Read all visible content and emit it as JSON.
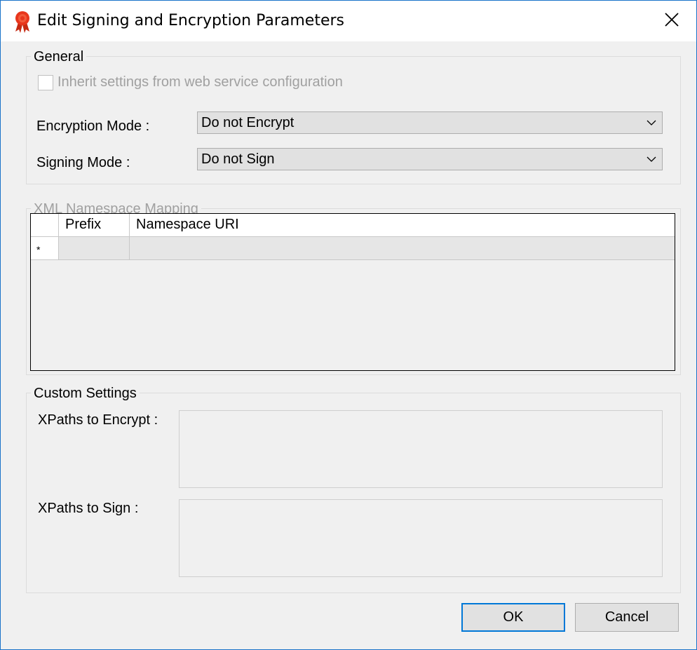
{
  "window": {
    "title": "Edit Signing and Encryption Parameters"
  },
  "general": {
    "title": "General",
    "inherit_label": "Inherit settings from web service configuration",
    "inherit_checked": false,
    "encryption_label": "Encryption Mode :",
    "encryption_value": "Do not Encrypt",
    "signing_label": "Signing Mode :",
    "signing_value": "Do not Sign"
  },
  "xml_mapping": {
    "title": "XML Namespace Mapping",
    "columns": [
      "Prefix",
      "Namespace URI"
    ],
    "new_row_marker": "*"
  },
  "custom": {
    "title": "Custom Settings",
    "encrypt_label": "XPaths to Encrypt :",
    "encrypt_value": "",
    "sign_label": "XPaths to Sign :",
    "sign_value": ""
  },
  "buttons": {
    "ok": "OK",
    "cancel": "Cancel"
  },
  "colors": {
    "window_border": "#1a73c9",
    "accent": "#0078d7",
    "icon_red": "#e8361c"
  },
  "icons": {
    "app": "ribbon-seal-icon",
    "close": "close-icon",
    "dropdown": "chevron-down-icon"
  }
}
